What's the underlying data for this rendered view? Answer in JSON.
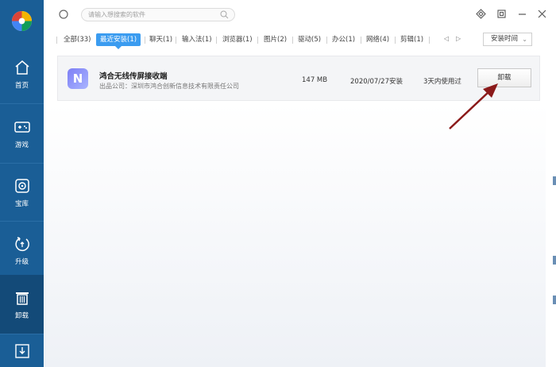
{
  "sidebar": {
    "items": [
      {
        "label": "首页",
        "icon": "home-icon"
      },
      {
        "label": "游戏",
        "icon": "gamepad-icon"
      },
      {
        "label": "宝库",
        "icon": "library-icon"
      },
      {
        "label": "升级",
        "icon": "upgrade-icon"
      },
      {
        "label": "卸载",
        "icon": "trash-icon",
        "active": true
      },
      {
        "label": "",
        "icon": "download-icon"
      }
    ],
    "colors": {
      "background": "#1a5e96",
      "active": "#134a78"
    }
  },
  "search": {
    "placeholder": "请输入想搜索的软件"
  },
  "tabs": [
    {
      "label": "全部(33)"
    },
    {
      "label": "最近安装(1)",
      "active": true
    },
    {
      "label": "聊天(1)"
    },
    {
      "label": "输入法(1)"
    },
    {
      "label": "浏览器(1)"
    },
    {
      "label": "图片(2)"
    },
    {
      "label": "驱动(5)"
    },
    {
      "label": "办公(1)"
    },
    {
      "label": "网络(4)"
    },
    {
      "label": "剪辑(1)"
    }
  ],
  "sort": {
    "value": "安装时间"
  },
  "app": {
    "name": "鸿合无线传屏接收端",
    "publisher": "出品公司：深圳市鸿合创新信息技术有限责任公司",
    "size": "147 MB",
    "install_date": "2020/07/27安装",
    "usage": "3天内使用过",
    "uninstall_label": "卸载",
    "icon": "app-logo-icon",
    "icon_letter": "N"
  },
  "accent_color": "#3b9cf0",
  "annotation_color": "#8b1a1a"
}
